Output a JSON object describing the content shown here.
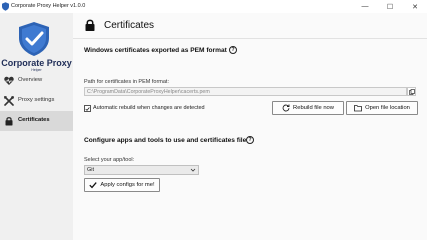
{
  "window": {
    "title": "Corporate Proxy Helper v1.0.0",
    "minimize_glyph": "—",
    "maximize_glyph": "☐",
    "close_glyph": "✕"
  },
  "sidebar": {
    "brand": "Corporate Proxy",
    "brand_sub": "Helper",
    "items": [
      {
        "label": "Overview",
        "icon": "heart-pulse-icon",
        "active": false
      },
      {
        "label": "Proxy settings",
        "icon": "tools-icon",
        "active": false
      },
      {
        "label": "Certificates",
        "icon": "lock-icon",
        "active": true
      }
    ]
  },
  "page": {
    "title": "Certificates"
  },
  "pem_section": {
    "title": "Windows certificates exported as PEM format",
    "help_glyph": "?",
    "path_label": "Path for certificates in PEM format:",
    "path_value": "C:\\ProgramData\\CorporateProxyHelper\\cacerts.pem",
    "auto_rebuild_label": "Automatic rebuild when changes are detected",
    "auto_rebuild_checked": true,
    "rebuild_button": "Rebuild file now",
    "open_location_button": "Open file location"
  },
  "apps_section": {
    "title": "Configure apps and tools to use and certificates file",
    "help_glyph": "?",
    "select_label": "Select your app/tool:",
    "selected_app": "Git",
    "apply_button": "Apply configs for me!"
  },
  "colors": {
    "brand": "#1f2d57",
    "shield": "#2d63b5",
    "sidebar_bg": "#f0f0f0",
    "active_item_bg": "#d9d9d9"
  }
}
